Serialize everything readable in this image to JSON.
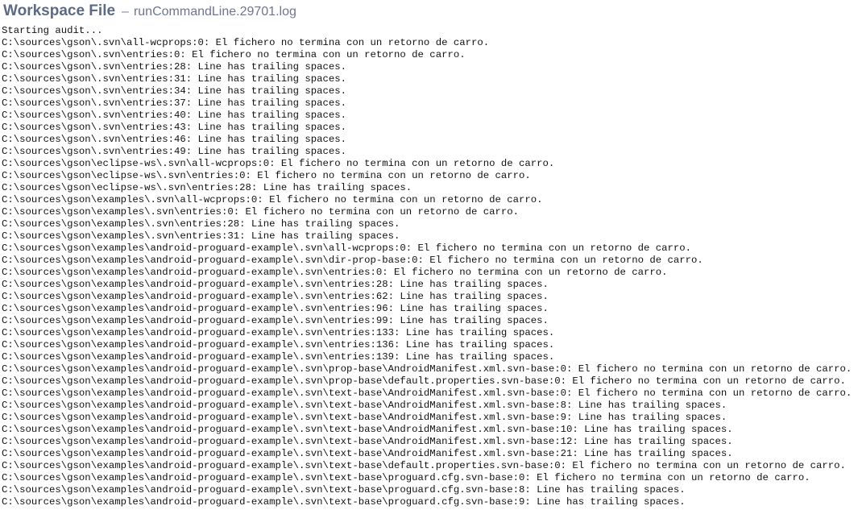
{
  "header": {
    "title": "Workspace File",
    "separator": "–",
    "filename": "runCommandLine.29701.log"
  },
  "log_lines": [
    "Starting audit...",
    "C:\\sources\\gson\\.svn\\all-wcprops:0: El fichero no termina con un retorno de carro.",
    "C:\\sources\\gson\\.svn\\entries:0: El fichero no termina con un retorno de carro.",
    "C:\\sources\\gson\\.svn\\entries:28: Line has trailing spaces.",
    "C:\\sources\\gson\\.svn\\entries:31: Line has trailing spaces.",
    "C:\\sources\\gson\\.svn\\entries:34: Line has trailing spaces.",
    "C:\\sources\\gson\\.svn\\entries:37: Line has trailing spaces.",
    "C:\\sources\\gson\\.svn\\entries:40: Line has trailing spaces.",
    "C:\\sources\\gson\\.svn\\entries:43: Line has trailing spaces.",
    "C:\\sources\\gson\\.svn\\entries:46: Line has trailing spaces.",
    "C:\\sources\\gson\\.svn\\entries:49: Line has trailing spaces.",
    "C:\\sources\\gson\\eclipse-ws\\.svn\\all-wcprops:0: El fichero no termina con un retorno de carro.",
    "C:\\sources\\gson\\eclipse-ws\\.svn\\entries:0: El fichero no termina con un retorno de carro.",
    "C:\\sources\\gson\\eclipse-ws\\.svn\\entries:28: Line has trailing spaces.",
    "C:\\sources\\gson\\examples\\.svn\\all-wcprops:0: El fichero no termina con un retorno de carro.",
    "C:\\sources\\gson\\examples\\.svn\\entries:0: El fichero no termina con un retorno de carro.",
    "C:\\sources\\gson\\examples\\.svn\\entries:28: Line has trailing spaces.",
    "C:\\sources\\gson\\examples\\.svn\\entries:31: Line has trailing spaces.",
    "C:\\sources\\gson\\examples\\android-proguard-example\\.svn\\all-wcprops:0: El fichero no termina con un retorno de carro.",
    "C:\\sources\\gson\\examples\\android-proguard-example\\.svn\\dir-prop-base:0: El fichero no termina con un retorno de carro.",
    "C:\\sources\\gson\\examples\\android-proguard-example\\.svn\\entries:0: El fichero no termina con un retorno de carro.",
    "C:\\sources\\gson\\examples\\android-proguard-example\\.svn\\entries:28: Line has trailing spaces.",
    "C:\\sources\\gson\\examples\\android-proguard-example\\.svn\\entries:62: Line has trailing spaces.",
    "C:\\sources\\gson\\examples\\android-proguard-example\\.svn\\entries:96: Line has trailing spaces.",
    "C:\\sources\\gson\\examples\\android-proguard-example\\.svn\\entries:99: Line has trailing spaces.",
    "C:\\sources\\gson\\examples\\android-proguard-example\\.svn\\entries:133: Line has trailing spaces.",
    "C:\\sources\\gson\\examples\\android-proguard-example\\.svn\\entries:136: Line has trailing spaces.",
    "C:\\sources\\gson\\examples\\android-proguard-example\\.svn\\entries:139: Line has trailing spaces.",
    "C:\\sources\\gson\\examples\\android-proguard-example\\.svn\\prop-base\\AndroidManifest.xml.svn-base:0: El fichero no termina con un retorno de carro.",
    "C:\\sources\\gson\\examples\\android-proguard-example\\.svn\\prop-base\\default.properties.svn-base:0: El fichero no termina con un retorno de carro.",
    "C:\\sources\\gson\\examples\\android-proguard-example\\.svn\\text-base\\AndroidManifest.xml.svn-base:0: El fichero no termina con un retorno de carro.",
    "C:\\sources\\gson\\examples\\android-proguard-example\\.svn\\text-base\\AndroidManifest.xml.svn-base:8: Line has trailing spaces.",
    "C:\\sources\\gson\\examples\\android-proguard-example\\.svn\\text-base\\AndroidManifest.xml.svn-base:9: Line has trailing spaces.",
    "C:\\sources\\gson\\examples\\android-proguard-example\\.svn\\text-base\\AndroidManifest.xml.svn-base:10: Line has trailing spaces.",
    "C:\\sources\\gson\\examples\\android-proguard-example\\.svn\\text-base\\AndroidManifest.xml.svn-base:12: Line has trailing spaces.",
    "C:\\sources\\gson\\examples\\android-proguard-example\\.svn\\text-base\\AndroidManifest.xml.svn-base:21: Line has trailing spaces.",
    "C:\\sources\\gson\\examples\\android-proguard-example\\.svn\\text-base\\default.properties.svn-base:0: El fichero no termina con un retorno de carro.",
    "C:\\sources\\gson\\examples\\android-proguard-example\\.svn\\text-base\\proguard.cfg.svn-base:0: El fichero no termina con un retorno de carro.",
    "C:\\sources\\gson\\examples\\android-proguard-example\\.svn\\text-base\\proguard.cfg.svn-base:8: Line has trailing spaces.",
    "C:\\sources\\gson\\examples\\android-proguard-example\\.svn\\text-base\\proguard.cfg.svn-base:9: Line has trailing spaces."
  ]
}
